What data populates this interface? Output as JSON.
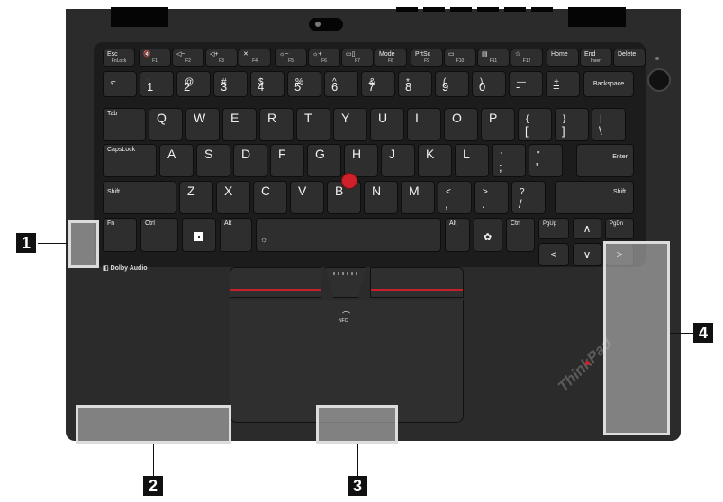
{
  "callouts": [
    {
      "number": "1"
    },
    {
      "number": "2"
    },
    {
      "number": "3"
    },
    {
      "number": "4"
    }
  ],
  "labels": {
    "dolby": "Dolby Audio",
    "nfc": "NFC",
    "brand_logo": "ThinkPad"
  },
  "keys": {
    "fn_row": [
      {
        "top": "Esc",
        "sub": "FnLock"
      },
      {
        "top": "🔇",
        "sub": "F1"
      },
      {
        "top": "◁−",
        "sub": "F2"
      },
      {
        "top": "◁+",
        "sub": "F3"
      },
      {
        "top": "✕",
        "sub": "F4"
      },
      {
        "top": "☼−",
        "sub": "F5"
      },
      {
        "top": "☼+",
        "sub": "F6"
      },
      {
        "top": "▭▯",
        "sub": "F7"
      },
      {
        "top": "Mode",
        "sub": "F8"
      },
      {
        "top": "PrtSc",
        "sub": "F9"
      },
      {
        "top": "▭",
        "sub": "F10"
      },
      {
        "top": "▤",
        "sub": "F11"
      },
      {
        "top": "☆",
        "sub": "F12"
      },
      {
        "top": "Home",
        "sub": ""
      },
      {
        "top": "End",
        "sub": "Insert"
      },
      {
        "top": "Delete",
        "sub": ""
      }
    ],
    "num_row": [
      {
        "upper": "~",
        "lower": "`"
      },
      {
        "upper": "!",
        "lower": "1"
      },
      {
        "upper": "@",
        "lower": "2"
      },
      {
        "upper": "#",
        "lower": "3"
      },
      {
        "upper": "$",
        "lower": "4"
      },
      {
        "upper": "%",
        "lower": "5"
      },
      {
        "upper": "^",
        "lower": "6"
      },
      {
        "upper": "&",
        "lower": "7"
      },
      {
        "upper": "*",
        "lower": "8"
      },
      {
        "upper": "(",
        "lower": "9"
      },
      {
        "upper": ")",
        "lower": "0"
      },
      {
        "upper": "—",
        "lower": "-"
      },
      {
        "upper": "+",
        "lower": "="
      }
    ],
    "backspace": "Backspace",
    "tab": "Tab",
    "qrow": [
      "Q",
      "W",
      "E",
      "R",
      "T",
      "Y",
      "U",
      "I",
      "O",
      "P"
    ],
    "qrow_sym": [
      {
        "upper": "{",
        "lower": "["
      },
      {
        "upper": "}",
        "lower": "]"
      },
      {
        "upper": "|",
        "lower": "\\"
      }
    ],
    "capslock": "CapsLock",
    "arow": [
      "A",
      "S",
      "D",
      "F",
      "G",
      "H",
      "J",
      "K",
      "L"
    ],
    "arow_sym": [
      {
        "upper": ":",
        "lower": ";"
      },
      {
        "upper": "\"",
        "lower": "'"
      }
    ],
    "enter": "Enter",
    "shift": "Shift",
    "zrow": [
      "Z",
      "X",
      "C",
      "V",
      "B",
      "N",
      "M"
    ],
    "zrow_sym": [
      {
        "upper": "<",
        "lower": ","
      },
      {
        "upper": ">",
        "lower": "."
      },
      {
        "upper": "?",
        "lower": "/"
      }
    ],
    "fn": "Fn",
    "ctrl": "Ctrl",
    "alt": "Alt",
    "pgup": "PgUp",
    "pgdn": "PgDn"
  },
  "colors": {
    "trackpoint": "#d0202a",
    "trackpad_stripe": "#c8202a",
    "highlight": "#dcdcdc"
  }
}
